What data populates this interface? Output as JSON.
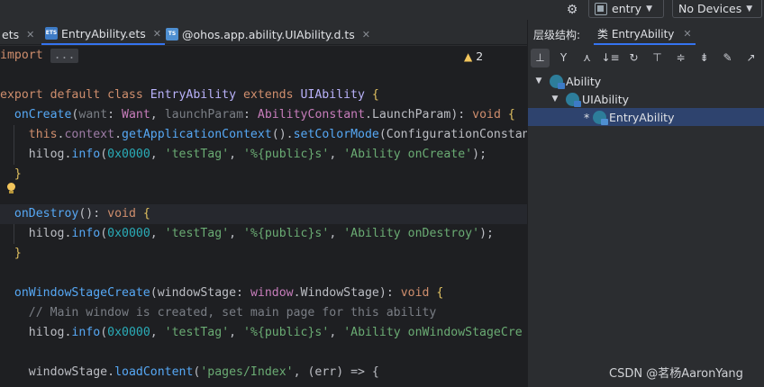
{
  "toolbar": {
    "module_label": "entry",
    "device_label": "No Devices",
    "settings_icon": "gear-icon"
  },
  "tabs": [
    {
      "label": "ets",
      "icon": "ets-file-icon"
    },
    {
      "label": "EntryAbility.ets",
      "icon": "ets-file-icon",
      "active": true
    },
    {
      "label": "@ohos.app.ability.UIAbility.d.ts",
      "icon": "ts-file-icon"
    }
  ],
  "editor": {
    "warnings_count": "2",
    "lines": {
      "l1_kw": "import",
      "l1_fold": "...",
      "l3_export": "export default class ",
      "l3_class": "EntryAbility",
      "l3_extends": " extends ",
      "l3_super": "UIAbility",
      "l3_brace": " {",
      "l4_fn": "onCreate",
      "l4_open": "(",
      "l4_p1": "want",
      "l4_c1": ": ",
      "l4_t1": "Want",
      "l4_cm": ", ",
      "l4_p2": "launchParam",
      "l4_c2": ": ",
      "l4_t2": "AbilityConstant",
      "l4_dot": ".",
      "l4_t3": "LaunchParam",
      "l4_close": "): ",
      "l4_void": "void",
      "l4_brace": " {",
      "l5_this": "this",
      "l5_a": ".",
      "l5_ctx": "context",
      "l5_b": ".",
      "l5_gac": "getApplicationContext",
      "l5_c": "().",
      "l5_scm": "setColorMode",
      "l5_d": "(ConfigurationConstan",
      "l6_hilog": "hilog",
      "l6_dot": ".",
      "l6_info": "info",
      "l6_open": "(",
      "l6_num": "0x0000",
      "l6_c1": ", ",
      "l6_s1": "'testTag'",
      "l6_c2": ", ",
      "l6_s2": "'%{public}s'",
      "l6_c3": ", ",
      "l6_s3": "'Ability onCreate'",
      "l6_end": ");",
      "l7_brace": "}",
      "l9_fn": "onDestroy",
      "l9_paren": "(): ",
      "l9_void": "void",
      "l9_brace": " {",
      "l10_hilog": "hilog",
      "l10_dot": ".",
      "l10_info": "info",
      "l10_open": "(",
      "l10_num": "0x0000",
      "l10_c1": ", ",
      "l10_s1": "'testTag'",
      "l10_c2": ", ",
      "l10_s2": "'%{public}s'",
      "l10_c3": ", ",
      "l10_s3": "'Ability onDestroy'",
      "l10_end": ");",
      "l11_brace": "}",
      "l13_fn": "onWindowStageCreate",
      "l13_open": "(",
      "l13_p": "windowStage",
      "l13_c": ": ",
      "l13_t1": "window",
      "l13_dot": ".",
      "l13_t2": "WindowStage",
      "l13_close": "): ",
      "l13_void": "void",
      "l13_brace": " {",
      "l14_cmt": "// Main window is created, set main page for this ability",
      "l15_hilog": "hilog",
      "l15_dot": ".",
      "l15_info": "info",
      "l15_open": "(",
      "l15_num": "0x0000",
      "l15_c1": ", ",
      "l15_s1": "'testTag'",
      "l15_c2": ", ",
      "l15_s2": "'%{public}s'",
      "l15_c3": ", ",
      "l15_s3": "'Ability onWindowStageCre",
      "l17_ws": "windowStage",
      "l17_dot": ".",
      "l17_lc": "loadContent",
      "l17_open": "(",
      "l17_s": "'pages/Index'",
      "l17_mid": ", (",
      "l17_err": "err",
      "l17_end": ") => {"
    }
  },
  "structure": {
    "title": "层级结构:",
    "tab_label": "类 EntryAbility",
    "tools": [
      "hierarchy-icon",
      "supertypes-icon",
      "subtypes-icon",
      "sort-icon",
      "refresh-icon",
      "scroll-to-source-icon",
      "expand-all-icon",
      "collapse-all-icon",
      "pin-icon",
      "export-icon"
    ],
    "tree": [
      {
        "label": "Ability",
        "level": 0
      },
      {
        "label": "UIAbility",
        "level": 1
      },
      {
        "label": "EntryAbility",
        "level": 2,
        "marker": "*",
        "selected": true
      }
    ]
  },
  "watermark": "CSDN @茗杨AaronYang",
  "colors": {
    "editor_bg": "#1e1f22",
    "panel_bg": "#2b2d30",
    "keyword": "#cf8e6d",
    "function": "#56a8f5",
    "string": "#6aab73",
    "number": "#2aacb8",
    "comment": "#7a7e85",
    "selection": "#2e436e",
    "accent": "#3574f0"
  }
}
